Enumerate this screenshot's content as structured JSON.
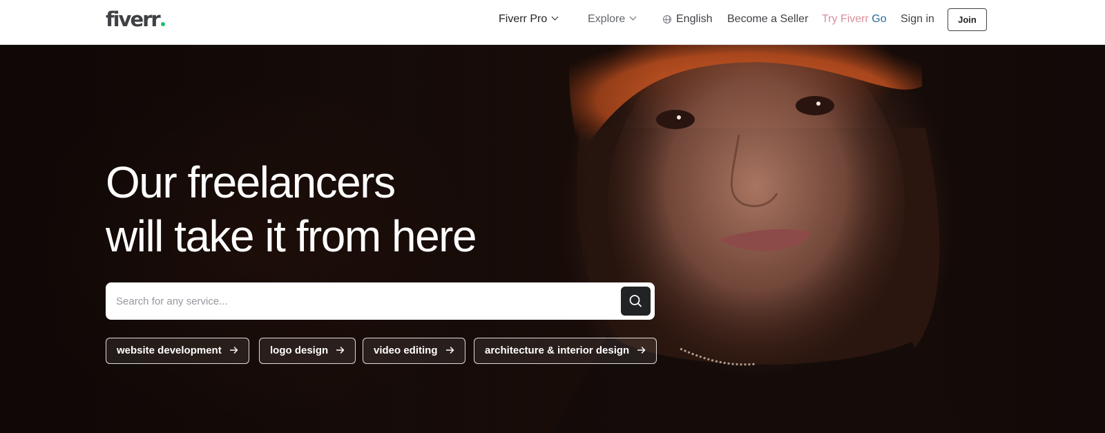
{
  "header": {
    "logo_text": "fiverr",
    "nav": {
      "fiverr_pro": "Fiverr Pro",
      "explore": "Explore",
      "language": "English",
      "become_seller": "Become a Seller",
      "try_go_part1": "Try Fiverr",
      "try_go_part2": " Go",
      "sign_in": "Sign in",
      "join": "Join"
    }
  },
  "hero": {
    "headline_line1": "Our freelancers",
    "headline_line2": "will take it from here",
    "search": {
      "placeholder": "Search for any service..."
    },
    "popular_chips": [
      {
        "label": "website development"
      },
      {
        "label": "logo design"
      },
      {
        "label": "video editing"
      },
      {
        "label": "architecture & interior design"
      }
    ]
  },
  "colors": {
    "brand_green": "#1dbf73",
    "text_dark": "#404145",
    "button_dark": "#222325",
    "try_go_pink": "#d58f9a",
    "try_go_blue": "#2b6a9a"
  },
  "icons": {
    "search": "magnifier-icon",
    "arrow": "arrow-right-icon",
    "globe": "globe-icon",
    "chevron": "chevron-down-icon"
  }
}
